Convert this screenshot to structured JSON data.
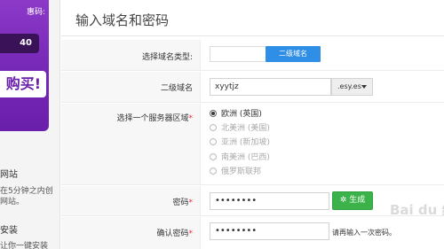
{
  "sidebar": {
    "promo_top": "惠码:",
    "promo_badge": "40",
    "promo_buy": "购买!",
    "website_title": "网站",
    "website_text_1": "在5分钟之内创",
    "website_text_2": "网站。",
    "install_title": "安装",
    "install_text": "让你一键安装"
  },
  "main": {
    "title": "输入域名和密码",
    "domain_type_label": "选择域名类型:",
    "domain_type_selected": "二级域名",
    "subdomain_label": "二级域名",
    "subdomain_value": "xyytjz",
    "subdomain_suffix": ".esy.es",
    "region_label": "选择一个服务器区域",
    "regions": [
      "欧洲 (英国)",
      "北美洲 (美国)",
      "亚洲 (新加坡)",
      "南美洲 (巴西)",
      "俄罗斯联邦"
    ],
    "password_label": "密码",
    "password_value": "••••••••",
    "generate_label": "生成",
    "confirm_label": "确认密码",
    "confirm_value": "••••••••",
    "confirm_hint": "请再输入一次密码。"
  },
  "watermark": "Bai du 经验",
  "colors": {
    "accent_blue": "#2f8ee5",
    "generate_green": "#3cb34a",
    "promo_purple": "#7527b5",
    "required_red": "#e23"
  }
}
